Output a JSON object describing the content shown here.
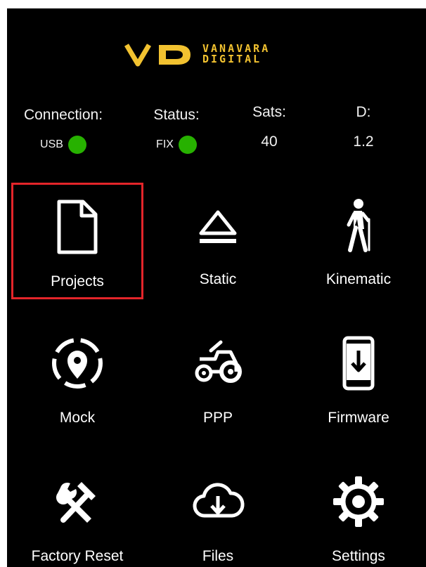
{
  "brand": {
    "line1": "VANAVARA",
    "line2": "DIGITAL",
    "mark": "VD",
    "color": "#f2c230"
  },
  "status": {
    "connection": {
      "label": "Connection:",
      "value": "USB",
      "indicator": "green"
    },
    "status": {
      "label": "Status:",
      "value": "FIX",
      "indicator": "green"
    },
    "sats": {
      "label": "Sats:",
      "value": "40"
    },
    "d": {
      "label": "D:",
      "value": "1.2"
    }
  },
  "menu": [
    {
      "label": "Projects",
      "icon": "document-icon",
      "selected": true
    },
    {
      "label": "Static",
      "icon": "eject-icon"
    },
    {
      "label": "Kinematic",
      "icon": "walking-person-icon"
    },
    {
      "label": "Mock",
      "icon": "location-pin-dashed-circle-icon"
    },
    {
      "label": "PPP",
      "icon": "tractor-icon"
    },
    {
      "label": "Firmware",
      "icon": "phone-download-icon"
    },
    {
      "label": "Factory Reset",
      "icon": "hammer-wrench-icon"
    },
    {
      "label": "Files",
      "icon": "cloud-download-icon"
    },
    {
      "label": "Settings",
      "icon": "gear-icon"
    }
  ],
  "colors": {
    "background": "#000000",
    "led": "#27b100",
    "selection": "#e4252a"
  }
}
